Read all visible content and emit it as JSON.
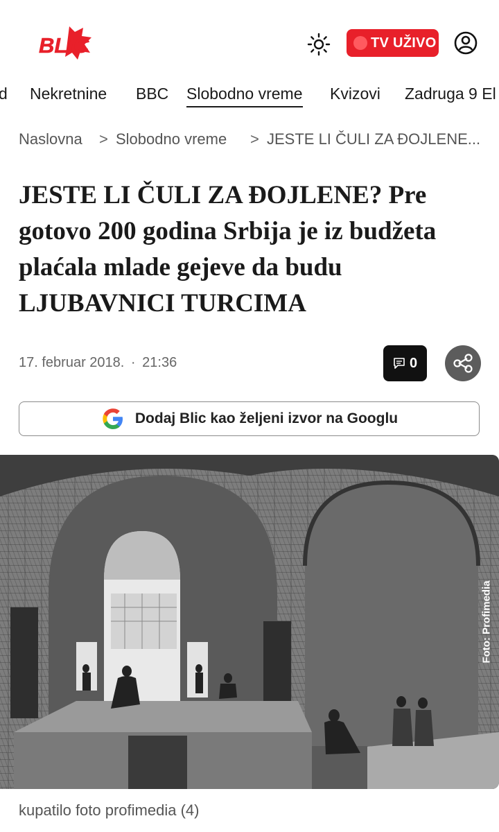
{
  "header": {
    "logo_text": "BLIC",
    "tv_label": "TV UŽIVO",
    "icons": {
      "theme": "sun-icon",
      "account": "account-icon"
    },
    "colors": {
      "brand_red": "#e8202a"
    }
  },
  "nav": {
    "items": [
      "d",
      "Nekretnine",
      "BBC",
      "Slobodno vreme",
      "Kvizovi",
      "Zadruga 9 El"
    ],
    "active": "Slobodno vreme"
  },
  "breadcrumb": {
    "items": [
      "Naslovna",
      "Slobodno vreme",
      "JESTE LI ČULI ZA ĐOJLENE..."
    ],
    "separator": ">"
  },
  "article": {
    "title": "JESTE LI ČULI ZA ĐOJLENE? Pre gotovo 200 godina Srbija je iz budžeta plaćala mlade gejeve da budu LJUBAVNICI TURCIMA",
    "date": "17. februar 2018.",
    "time": "21:36",
    "date_separator": "·",
    "comments_count": "0",
    "google_button_label": "Dodaj Blic kao željeni izvor na Googlu",
    "photo_credit": "Foto: Profimedia",
    "caption": "kupatilo foto profimedia (4)"
  }
}
